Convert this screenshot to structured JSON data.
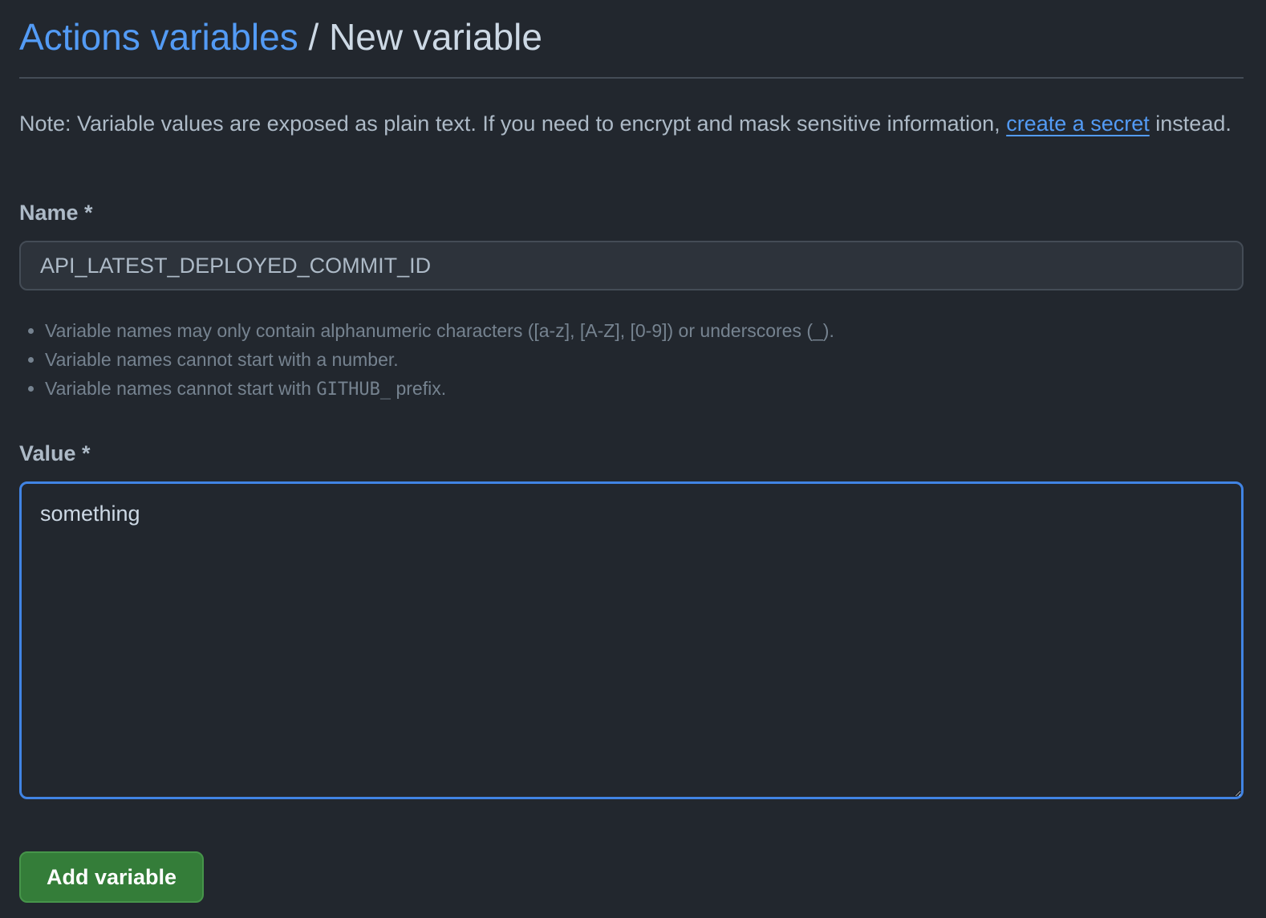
{
  "header": {
    "breadcrumb_link": "Actions variables",
    "separator": " / ",
    "current_page": "New variable"
  },
  "note": {
    "text_before_link": "Note: Variable values are exposed as plain text. If you need to encrypt and mask sensitive information, ",
    "link_text": "create a secret",
    "text_after_link": " instead."
  },
  "name_field": {
    "label": "Name *",
    "value": "API_LATEST_DEPLOYED_COMMIT_ID"
  },
  "rules": {
    "items": [
      "Variable names may only contain alphanumeric characters ([a-z], [A-Z], [0-9]) or underscores (_).",
      "Variable names cannot start with a number."
    ],
    "third_prefix": "Variable names cannot start with ",
    "third_code": "GITHUB_",
    "third_suffix": " prefix."
  },
  "value_field": {
    "label": "Value *",
    "value": "something"
  },
  "actions": {
    "add_label": "Add variable"
  },
  "colors": {
    "background": "#22272e",
    "link": "#539bf5",
    "focus_border": "#4184e4",
    "primary_button": "#347d39"
  }
}
